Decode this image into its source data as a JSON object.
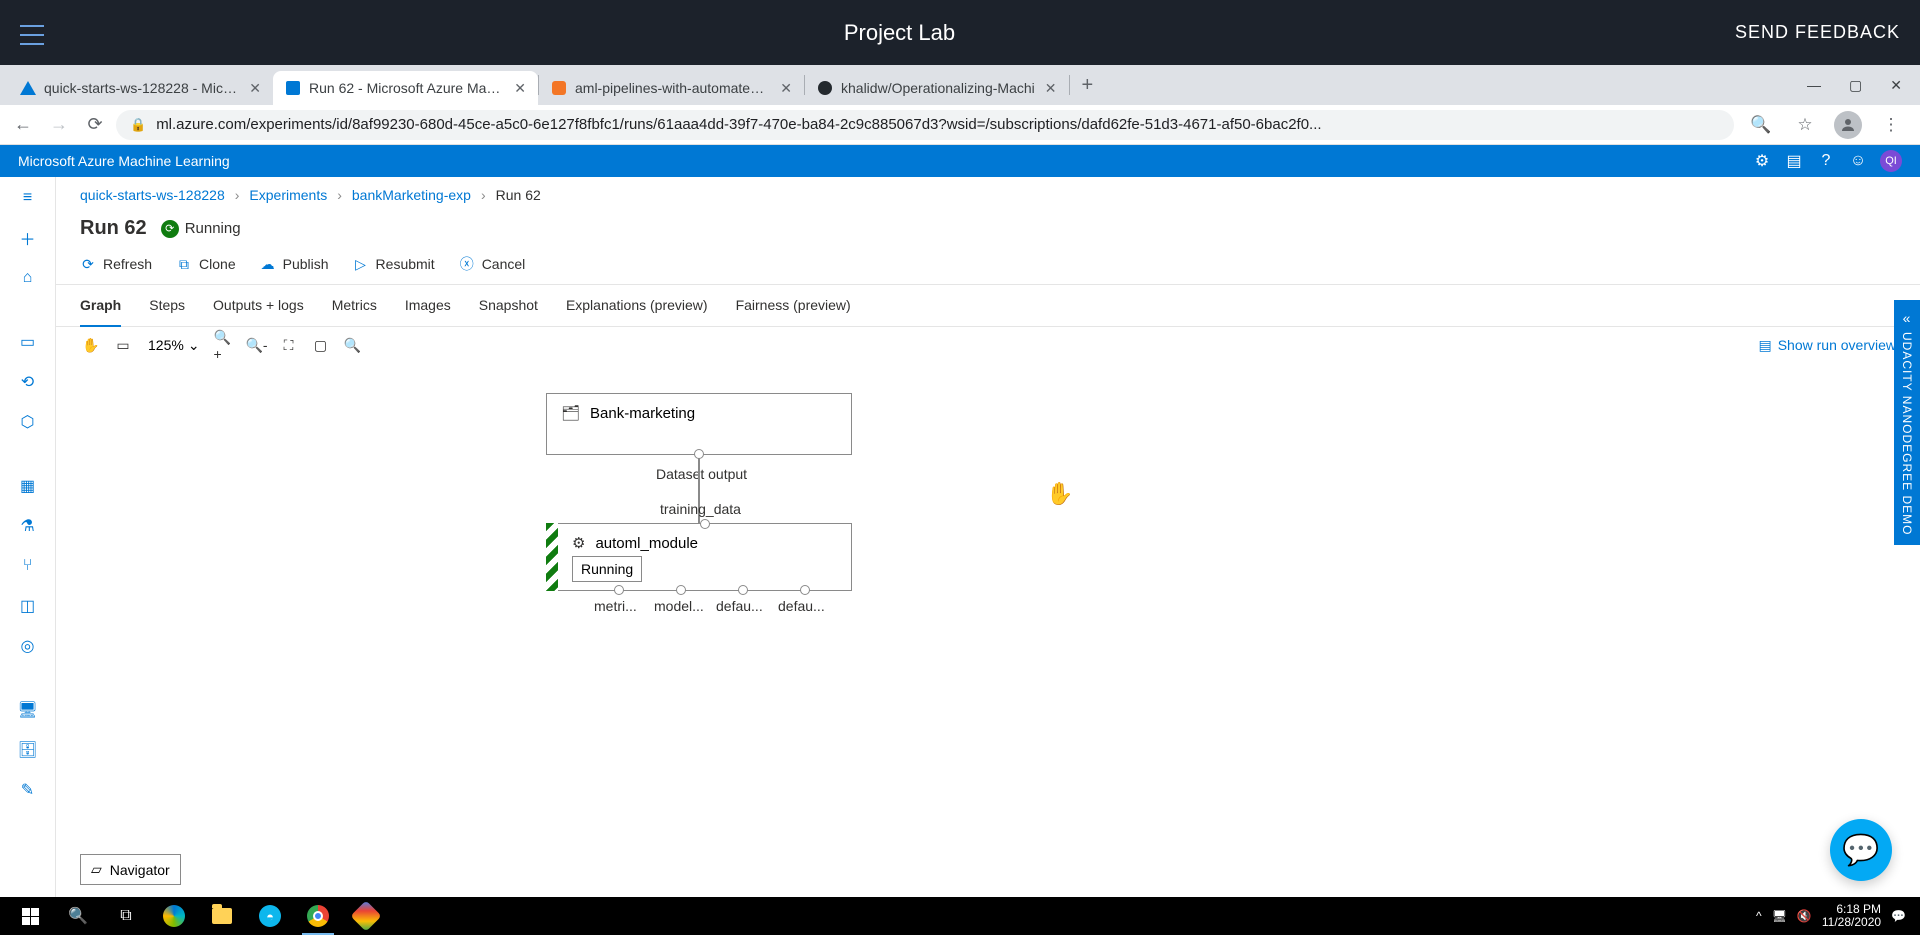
{
  "header": {
    "title": "Project Lab",
    "feedback": "SEND FEEDBACK"
  },
  "browser": {
    "tabs": [
      {
        "title": "quick-starts-ws-128228 - Microso"
      },
      {
        "title": "Run 62 - Microsoft Azure Machin"
      },
      {
        "title": "aml-pipelines-with-automated-m"
      },
      {
        "title": "khalidw/Operationalizing-Machi"
      }
    ],
    "url": "ml.azure.com/experiments/id/8af99230-680d-45ce-a5c0-6e127f8fbfc1/runs/61aaa4dd-39f7-470e-ba84-2c9c885067d3?wsid=/subscriptions/dafd62fe-51d3-4671-af50-6bac2f0..."
  },
  "aml": {
    "product": "Microsoft Azure Machine Learning"
  },
  "breadcrumb": {
    "workspace": "quick-starts-ws-128228",
    "experiments": "Experiments",
    "experiment": "bankMarketing-exp",
    "run": "Run 62"
  },
  "page": {
    "title": "Run 62",
    "status": "Running"
  },
  "actions": {
    "refresh": "Refresh",
    "clone": "Clone",
    "publish": "Publish",
    "resubmit": "Resubmit",
    "cancel": "Cancel"
  },
  "tabs": {
    "graph": "Graph",
    "steps": "Steps",
    "outputs": "Outputs + logs",
    "metrics": "Metrics",
    "images": "Images",
    "snapshot": "Snapshot",
    "explanations": "Explanations (preview)",
    "fairness": "Fairness (preview)"
  },
  "toolbar": {
    "zoom": "125%",
    "overview": "Show run overview"
  },
  "graph": {
    "node1": {
      "title": "Bank-marketing",
      "outLabel": "Dataset output"
    },
    "edgeLabel": "training_data",
    "node2": {
      "title": "automl_module",
      "status": "Running",
      "outs": [
        "metri...",
        "model...",
        "defau...",
        "defau..."
      ]
    }
  },
  "navigator": "Navigator",
  "sideFlag": "UDACITY NANODEGREE DEMO",
  "taskbar": {
    "time": "6:18 PM",
    "date": "11/28/2020"
  }
}
